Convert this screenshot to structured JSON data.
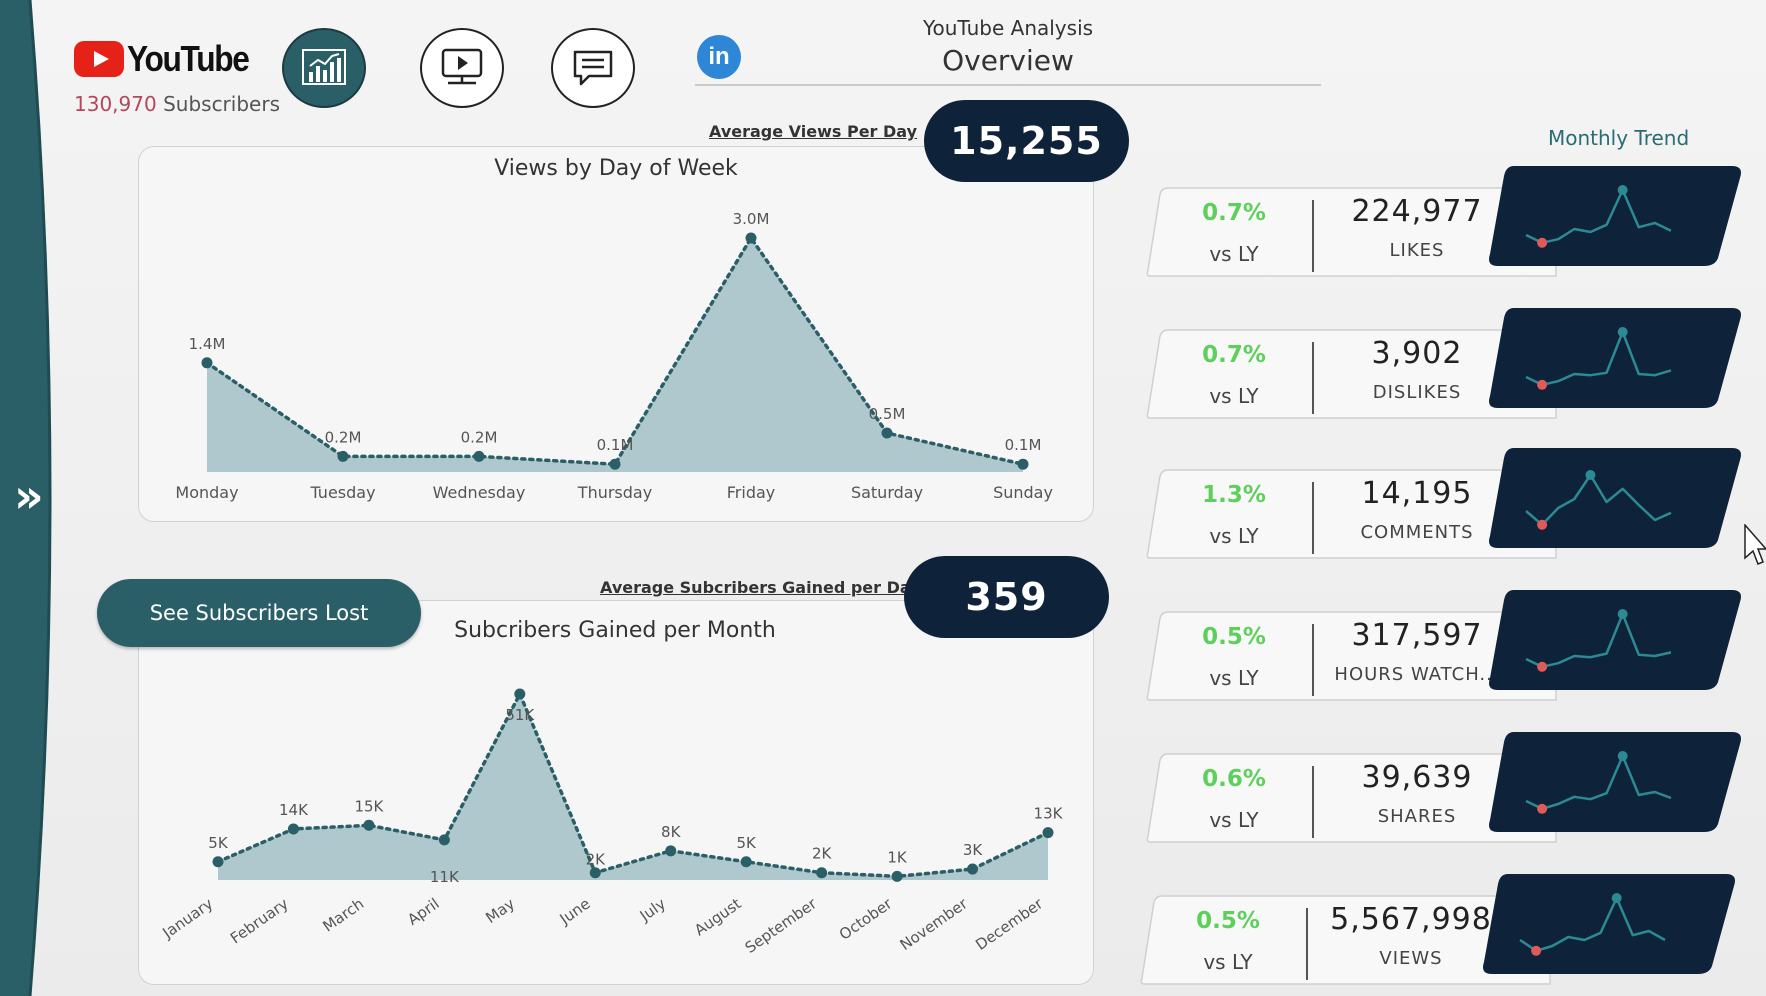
{
  "header": {
    "brand": "YouTube",
    "subscribers_count": "130,970",
    "subscribers_label": "Subscribers",
    "title_small": "YouTube Analysis",
    "title_big": "Overview",
    "linkedin_label": "in"
  },
  "nav": {
    "buttons": [
      {
        "icon": "bar-line-chart-icon",
        "active": true
      },
      {
        "icon": "video-play-icon",
        "active": false
      },
      {
        "icon": "comment-icon",
        "active": false
      }
    ],
    "rail_icon": "double-chevron-right-icon"
  },
  "views_section": {
    "avg_label": "Average Views Per Day",
    "avg_value": "15,255"
  },
  "subs_section": {
    "avg_label": "Average Subcribers Gained per Day",
    "avg_value": "359",
    "see_lost_label": "See Subscribers Lost"
  },
  "chart_data": [
    {
      "type": "area",
      "title": "Views by Day of Week",
      "categories": [
        "Monday",
        "Tuesday",
        "Wednesday",
        "Thursday",
        "Friday",
        "Saturday",
        "Sunday"
      ],
      "values": [
        1.4,
        0.2,
        0.2,
        0.1,
        3.0,
        0.5,
        0.1
      ],
      "data_labels": [
        "1.4M",
        "0.2M",
        "0.2M",
        "0.1M",
        "3.0M",
        "0.5M",
        "0.1M"
      ],
      "unit": "M",
      "ylim": [
        0,
        3.0
      ],
      "line_style": "dotted",
      "color": "#2b5f67",
      "fill": "#aac5cb"
    },
    {
      "type": "area",
      "title": "Subcribers Gained per Month",
      "categories": [
        "January",
        "February",
        "March",
        "April",
        "May",
        "June",
        "July",
        "August",
        "September",
        "October",
        "November",
        "December"
      ],
      "values": [
        5,
        14,
        15,
        11,
        51,
        2,
        8,
        5,
        2,
        1,
        3,
        13
      ],
      "data_labels": [
        "5K",
        "14K",
        "15K",
        "11K",
        "51K",
        "2K",
        "8K",
        "5K",
        "2K",
        "1K",
        "3K",
        "13K"
      ],
      "unit": "K",
      "ylim": [
        0,
        51
      ],
      "line_style": "dotted",
      "color": "#2b5f67",
      "fill": "#aac5cb"
    }
  ],
  "monthly_trend": {
    "title": "Monthly Trend",
    "kpis": [
      {
        "pct": "0.7%",
        "vs": "vs LY",
        "value": "224,977",
        "name": "LIKES",
        "spark": [
          0.25,
          0.12,
          0.18,
          0.35,
          0.3,
          0.42,
          1.0,
          0.38,
          0.45,
          0.32
        ]
      },
      {
        "pct": "0.7%",
        "vs": "vs LY",
        "value": "3,902",
        "name": "DISLIKES",
        "spark": [
          0.25,
          0.12,
          0.18,
          0.3,
          0.28,
          0.32,
          1.0,
          0.3,
          0.28,
          0.36
        ]
      },
      {
        "pct": "1.3%",
        "vs": "vs LY",
        "value": "14,195",
        "name": "COMMENTS",
        "spark": [
          0.35,
          0.12,
          0.4,
          0.55,
          0.95,
          0.5,
          0.72,
          0.45,
          0.2,
          0.32
        ]
      },
      {
        "pct": "0.5%",
        "vs": "vs LY",
        "value": "317,597",
        "name": "HOURS WATCH...",
        "spark": [
          0.25,
          0.12,
          0.18,
          0.3,
          0.28,
          0.34,
          1.0,
          0.32,
          0.3,
          0.36
        ]
      },
      {
        "pct": "0.6%",
        "vs": "vs LY",
        "value": "39,639",
        "name": "SHARES",
        "spark": [
          0.25,
          0.12,
          0.2,
          0.32,
          0.28,
          0.38,
          1.0,
          0.35,
          0.4,
          0.3
        ]
      },
      {
        "pct": "0.5%",
        "vs": "vs LY",
        "value": "5,567,998",
        "name": "VIEWS",
        "spark": [
          0.3,
          0.12,
          0.2,
          0.35,
          0.3,
          0.42,
          1.0,
          0.38,
          0.45,
          0.3
        ]
      }
    ],
    "accent": "#5cd05a",
    "spark_bg": "#0e2239",
    "spark_line": "#2b8a94",
    "spark_min": "#e05a5a"
  }
}
